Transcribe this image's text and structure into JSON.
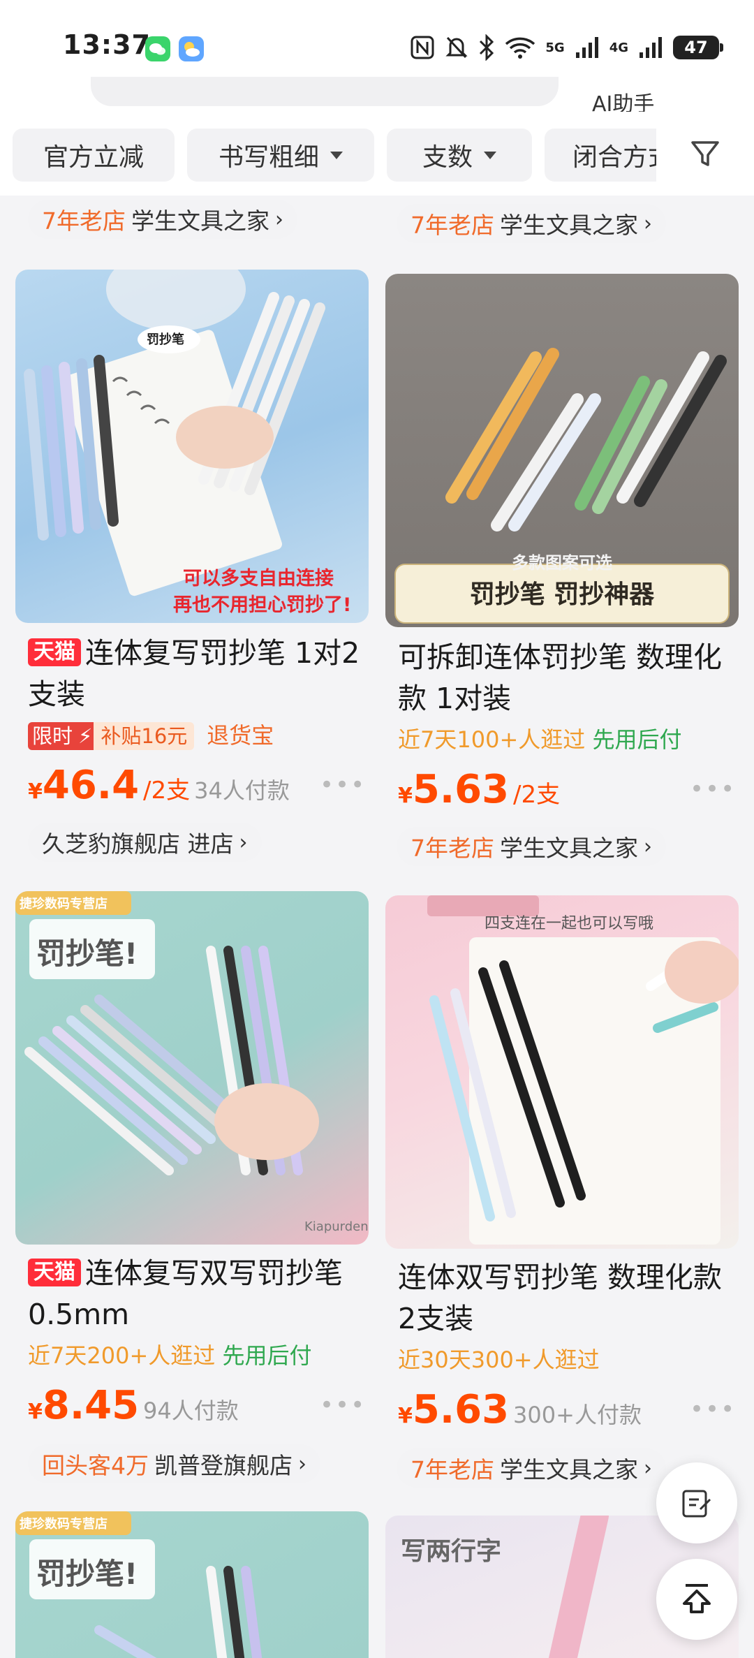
{
  "status_bar": {
    "time": "13:37",
    "battery": "47",
    "net1": "5G",
    "net2": "4G"
  },
  "header": {
    "ai_helper": "AI助手"
  },
  "filters": [
    {
      "label": "官方立减",
      "has_caret": false
    },
    {
      "label": "书写粗细",
      "has_caret": true
    },
    {
      "label": "支数",
      "has_caret": true
    },
    {
      "label": "闭合方式",
      "has_caret": false
    }
  ],
  "top_stores": [
    {
      "tag": "7年老店",
      "name": "学生文具之家"
    },
    {
      "tag": "7年老店",
      "name": "学生文具之家"
    }
  ],
  "products": [
    {
      "badge": "天猫",
      "title": "连体复写罚抄笔 1对2支装",
      "promo_label": "限时",
      "promo_value": "补贴16元",
      "refund": "退货宝",
      "price_currency": "¥",
      "price": "46.4",
      "price_unit": "/2支",
      "sold": "34人付款",
      "store_tag": "",
      "store_name": "久芝豹旗舰店 进店",
      "image_caption_1": "可以多支自由连接",
      "image_caption_2": "再也不用担心罚抄了!",
      "image_badge": "罚抄笔"
    },
    {
      "title": "可拆卸连体罚抄笔 数理化款 1对装",
      "meta_orange": "近7天100+人逛过",
      "meta_green": "先用后付",
      "price_currency": "¥",
      "price": "5.63",
      "price_unit": "/2支",
      "sold": "",
      "store_tag": "7年老店",
      "store_name": "学生文具之家",
      "image_caption_1": "多款图案可选",
      "image_caption_2": "罚抄笔 罚抄神器"
    },
    {
      "badge": "天猫",
      "title": "连体复写双写罚抄笔 0.5mm",
      "meta_orange": "近7天200+人逛过",
      "meta_green": "先用后付",
      "price_currency": "¥",
      "price": "8.45",
      "sold": "94人付款",
      "store_tag": "回头客4万",
      "store_name": "凯普登旗舰店",
      "image_shop_label": "捷珍数码专营店",
      "image_title": "罚抄笔!",
      "image_brand": "Kiapurden"
    },
    {
      "title": "连体双写罚抄笔 数理化款 2支装",
      "meta_orange": "近30天300+人逛过",
      "price_currency": "¥",
      "price": "5.63",
      "sold": "300+人付款",
      "store_tag": "7年老店",
      "store_name": "学生文具之家",
      "image_caption_1": "四支连在一起也可以写哦"
    },
    {
      "image_shop_label": "捷珍数码专营店",
      "image_title": "罚抄笔!"
    },
    {
      "image_caption_1": "写两行字"
    }
  ],
  "more_label": "•••",
  "colors": {
    "price": "#ff4a00",
    "store_tag": "#f06a2a",
    "tmall": "#ff2d3a",
    "green": "#2fa84f"
  }
}
